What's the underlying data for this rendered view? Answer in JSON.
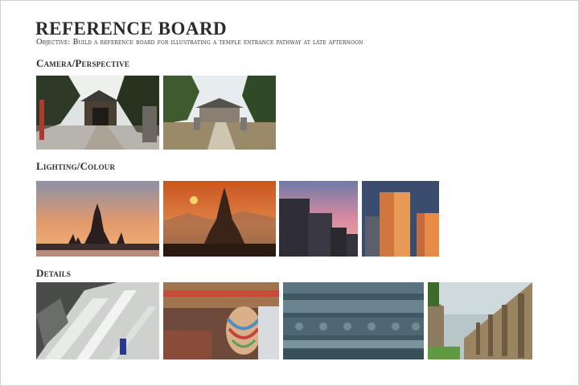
{
  "board": {
    "title": "REFERENCE BOARD",
    "objective": "Objective: Build a reference board for illustrating a temple entrance pathway at late afternoon"
  },
  "sections": [
    {
      "heading": "Camera/Perspective",
      "images": [
        "temple-gate-courtyard-photo",
        "shrine-approach-path-photo"
      ]
    },
    {
      "heading": "Lighting/Colour",
      "images": [
        "wat-arun-sunset-silhouette-photo",
        "pagoda-orange-sunset-photo",
        "apartment-blocks-pink-sky-photo",
        "tower-block-golden-light-photo"
      ]
    },
    {
      "heading": "Details",
      "images": [
        "carved-white-stone-stairway-photo",
        "painted-ornate-pillar-photo",
        "carved-stone-frieze-photo",
        "temple-colonnade-corridor-photo"
      ]
    }
  ]
}
